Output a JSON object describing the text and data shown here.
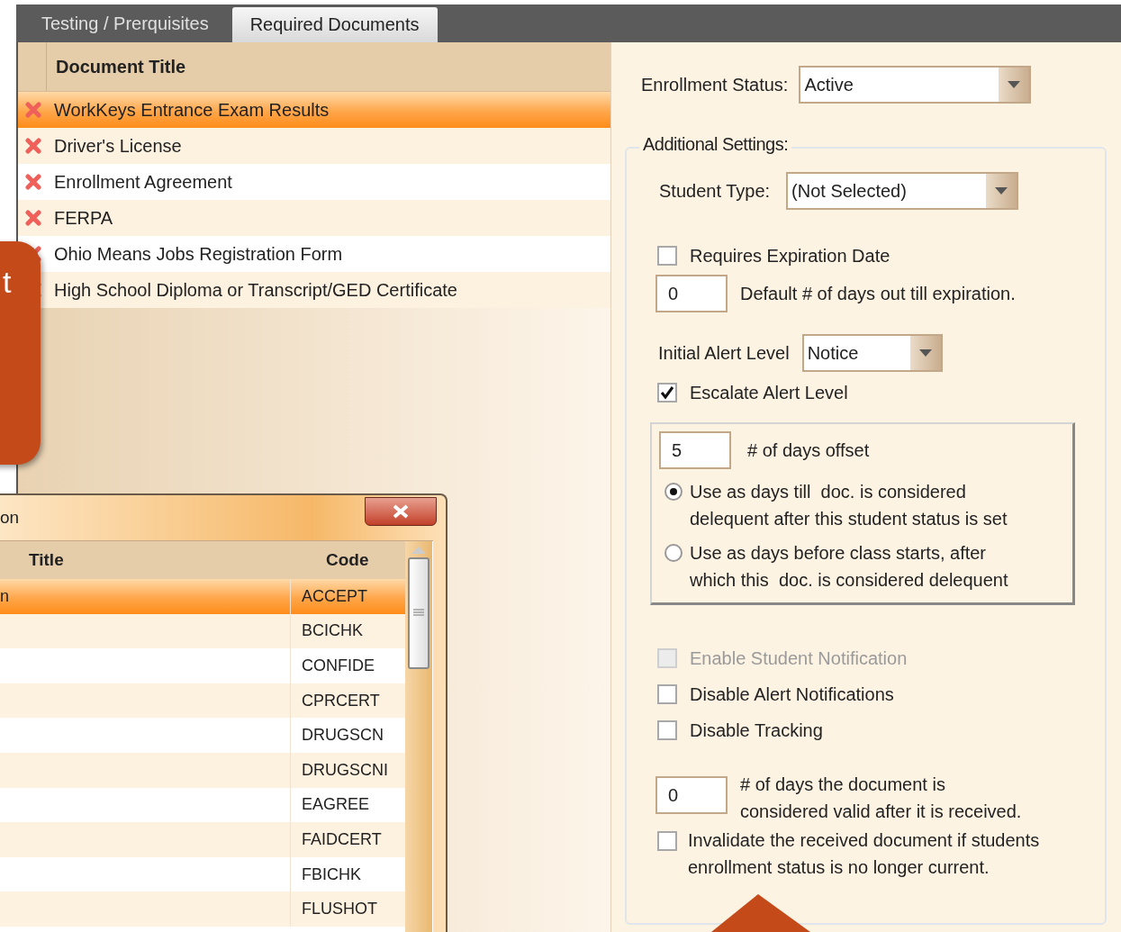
{
  "tabs": [
    {
      "label": "Testing / Prerquisites",
      "selected": false
    },
    {
      "label": "Required Documents",
      "selected": true
    }
  ],
  "document_list": {
    "column": "Document Title",
    "rows": [
      {
        "title": "WorkKeys Entrance Exam Results",
        "selected": true
      },
      {
        "title": "Driver's License",
        "selected": false
      },
      {
        "title": "Enrollment Agreement",
        "selected": false
      },
      {
        "title": "FERPA",
        "selected": false
      },
      {
        "title": "Ohio Means Jobs Registration Form",
        "selected": false
      },
      {
        "title": "High School Diploma or Transcript/GED Certificate",
        "selected": false
      }
    ]
  },
  "settings": {
    "enrollment_status": {
      "label": "Enrollment Status:",
      "value": "Active"
    },
    "additional_settings": {
      "legend": "Additional Settings:",
      "student_type": {
        "label": "Student Type:",
        "value": "(Not Selected)"
      },
      "requires_expiration": {
        "label": "Requires Expiration Date",
        "checked": false
      },
      "expiration_days": {
        "value": "0",
        "label": "Default # of days out till expiration."
      },
      "initial_alert_level": {
        "label": "Initial Alert Level",
        "value": "Notice"
      },
      "escalate_alert_level": {
        "label": "Escalate Alert Level",
        "checked": true
      },
      "offset": {
        "value": "5",
        "label": "# of days offset",
        "options": [
          {
            "label": "Use as days till  doc. is considered delequent after this student status is set",
            "selected": true
          },
          {
            "label": "Use as days before class starts, after which this  doc. is considered delequent",
            "selected": false
          }
        ]
      },
      "options": [
        {
          "label": "Enable Student Notification",
          "checked": false,
          "disabled": true
        },
        {
          "label": "Disable Alert Notifications",
          "checked": false,
          "disabled": false
        },
        {
          "label": "Disable Tracking",
          "checked": false,
          "disabled": false
        }
      ],
      "valid_days": {
        "value": "0",
        "label": "# of days the document is considered valid after it is received."
      },
      "invalidate": {
        "label": "Invalidate the received document if students enrollment status is no longer current.",
        "checked": false
      }
    }
  },
  "callout": {
    "text": "t"
  },
  "dialog": {
    "title": "on",
    "columns": [
      "Title",
      "Code"
    ],
    "rows": [
      {
        "title": "n",
        "code": "ACCEPT",
        "selected": true
      },
      {
        "code": "BCICHK",
        "selected": false
      },
      {
        "code": "CONFIDE",
        "selected": false
      },
      {
        "code": "CPRCERT",
        "selected": false
      },
      {
        "code": "DRUGSCN",
        "selected": false
      },
      {
        "code": "DRUGSCNI",
        "selected": false
      },
      {
        "code": "EAGREE",
        "selected": false
      },
      {
        "code": "FAIDCERT",
        "selected": false
      },
      {
        "code": "FBICHK",
        "selected": false
      },
      {
        "code": "FLUSHOT",
        "selected": false
      }
    ]
  }
}
